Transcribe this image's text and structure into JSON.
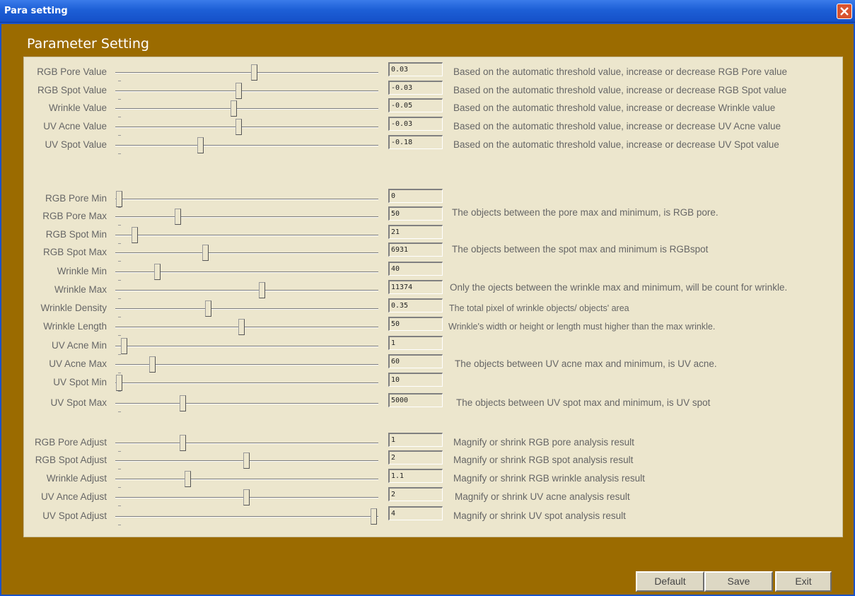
{
  "window": {
    "title": "Para setting"
  },
  "panel": {
    "title": "Parameter Setting"
  },
  "rows": [
    {
      "label": "RGB Pore Value",
      "value": "0.03",
      "desc": "Based on the automatic threshold value, increase or decrease RGB  Pore value",
      "position": 0.53
    },
    {
      "label": "RGB Spot Value",
      "value": "-0.03",
      "desc": "Based on the automatic threshold value, increase or decrease RGB  Spot value",
      "position": 0.47
    },
    {
      "label": "Wrinkle Value",
      "value": "-0.05",
      "desc": "Based on the automatic threshold value, increase or decrease Wrinkle value",
      "position": 0.45
    },
    {
      "label": "UV Acne Value",
      "value": "-0.03",
      "desc": "Based on the automatic threshold value, increase or decrease UV Acne value",
      "position": 0.47
    },
    {
      "label": "UV Spot Value",
      "value": "-0.18",
      "desc": "Based on the automatic threshold value, increase or decrease UV Spot value",
      "position": 0.32
    },
    {
      "label": "RGB Pore Min",
      "value": "0",
      "desc": "",
      "position": 0.0
    },
    {
      "label": "RGB Pore Max",
      "value": "50",
      "desc": "",
      "position": 0.23
    },
    {
      "label": "RGB Spot Min",
      "value": "21",
      "desc": "",
      "position": 0.06
    },
    {
      "label": "RGB Spot Max",
      "value": "6931",
      "desc": "",
      "position": 0.34
    },
    {
      "label": "Wrinkle Min",
      "value": "40",
      "desc": "",
      "position": 0.15
    },
    {
      "label": "Wrinkle Max",
      "value": "11374",
      "desc": "",
      "position": 0.56
    },
    {
      "label": "Wrinkle Density",
      "value": "0.35",
      "desc": "The total pixel of wrinkle objects/ objects' area",
      "position": 0.35
    },
    {
      "label": "Wrinkle Length",
      "value": "50",
      "desc": "Wrinkle's width or height or length must higher than the max wrinkle.",
      "position": 0.48
    },
    {
      "label": "UV Acne Min",
      "value": "1",
      "desc": "",
      "position": 0.02
    },
    {
      "label": "UV Acne Max",
      "value": "60",
      "desc": "The objects between UV acne max and minimum, is UV acne.",
      "position": 0.13
    },
    {
      "label": "UV Spot Min",
      "value": "10",
      "desc": "",
      "position": 0.0
    },
    {
      "label": "UV Spot Max",
      "value": "5000",
      "desc": "The objects between UV spot max and minimum, is UV spot",
      "position": 0.25
    },
    {
      "label": "RGB Pore Adjust",
      "value": "1",
      "desc": "Magnify or shrink RGB pore analysis result",
      "position": 0.25
    },
    {
      "label": "RGB Spot Adjust",
      "value": "2",
      "desc": "Magnify or shrink RGB spot analysis result",
      "position": 0.5
    },
    {
      "label": "Wrinkle Adjust",
      "value": "1.1",
      "desc": "Magnify or shrink RGB wrinkle analysis result",
      "position": 0.27
    },
    {
      "label": "UV Ance Adjust",
      "value": "2",
      "desc": "Magnify or shrink UV acne analysis result",
      "position": 0.5
    },
    {
      "label": "UV Spot Adjust",
      "value": "4",
      "desc": "Magnify or shrink UV spot analysis result",
      "position": 1.0
    }
  ],
  "pair_descriptions": [
    "The objects between the pore max and minimum, is RGB pore.",
    "The objects between the spot max and minimum is RGBspot",
    "Only the ojects between the wrinkle max and minimum, will be count for wrinkle."
  ],
  "buttons": {
    "default": "Default",
    "save": "Save",
    "exit": "Exit"
  },
  "colors": {
    "frame": "#9b6b00",
    "panel": "#ece6cd",
    "titlebar": "#1d5fd6",
    "close": "#d9532f"
  }
}
